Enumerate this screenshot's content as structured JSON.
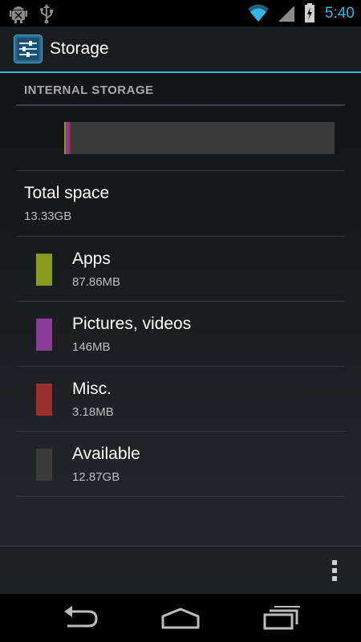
{
  "status_bar": {
    "time": "5:40",
    "accent_color": "#33b5e5",
    "left_icons": [
      "android-debug-icon",
      "usb-icon"
    ],
    "right_icons": [
      "wifi-icon",
      "signal-icon",
      "battery-charging-icon"
    ]
  },
  "action_bar": {
    "title": "Storage",
    "icon": "settings-sliders-icon"
  },
  "section": {
    "header": "INTERNAL STORAGE"
  },
  "usage_bar": {
    "segments": [
      {
        "name": "Apps",
        "color": "#8a9a1c",
        "fraction": 0.0066
      },
      {
        "name": "Pictures, videos",
        "color": "#8c3a9c",
        "fraction": 0.011
      },
      {
        "name": "Misc.",
        "color": "#9a2e2e",
        "fraction": 0.0002
      },
      {
        "name": "Available",
        "color": "#3b3b3b",
        "fraction": 0.9655
      }
    ]
  },
  "total": {
    "label": "Total space",
    "value": "13.33GB"
  },
  "items": [
    {
      "label": "Apps",
      "value": "87.86MB",
      "color": "#8a9a1c"
    },
    {
      "label": "Pictures, videos",
      "value": "146MB",
      "color": "#8c3a9c"
    },
    {
      "label": "Misc.",
      "value": "3.18MB",
      "color": "#9a2e2e"
    },
    {
      "label": "Available",
      "value": "12.87GB",
      "color": "#3b3b3b"
    }
  ],
  "bottom_bar": {
    "overflow_icon": "overflow-menu-icon"
  },
  "nav_bar": {
    "buttons": [
      "back-icon",
      "home-icon",
      "recent-apps-icon"
    ]
  }
}
